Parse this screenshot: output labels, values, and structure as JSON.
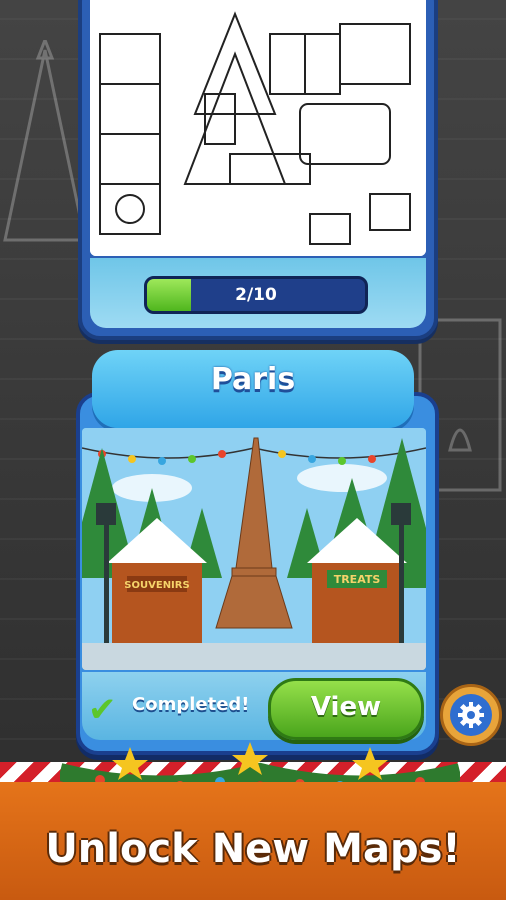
{
  "top_card": {
    "progress_text": "2/10",
    "progress_fraction": 0.2
  },
  "paris_card": {
    "title": "Paris",
    "status_text": "Completed!",
    "view_label": "View",
    "sign_left": "SOUVENIRS",
    "sign_right": "TREATS"
  },
  "settings": {
    "icon": "gear-icon"
  },
  "footer": {
    "text": "Unlock New Maps!"
  },
  "colors": {
    "accent_blue": "#2f6ed0",
    "progress_green": "#4fb61e",
    "button_green": "#4aa51c",
    "footer_orange": "#e5741a"
  }
}
